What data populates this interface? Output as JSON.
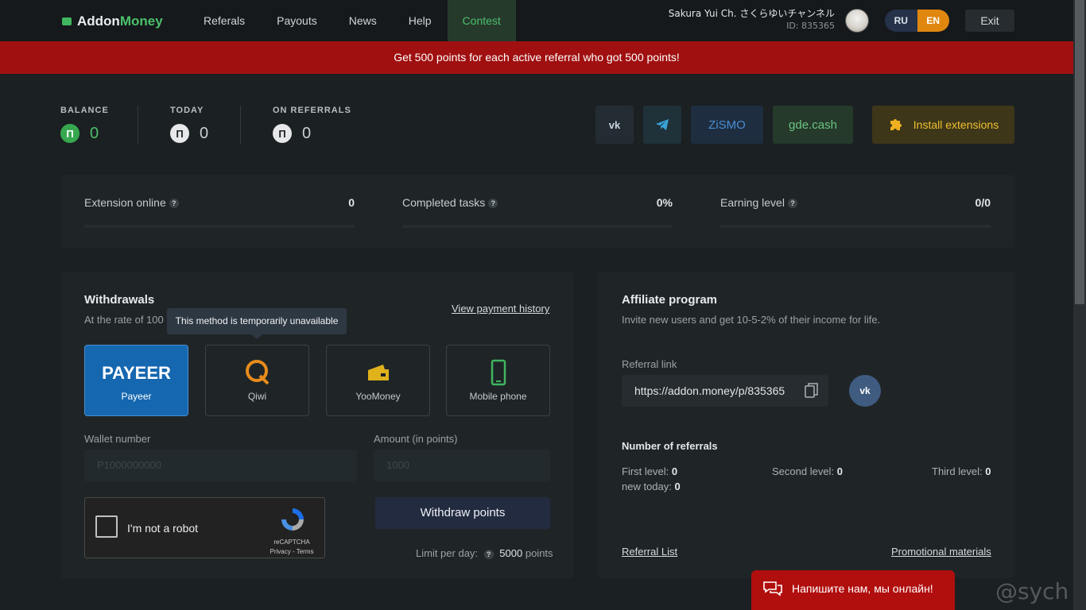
{
  "header": {
    "logo_part1": "Addon",
    "logo_part2": "Money",
    "nav": [
      "Referals",
      "Payouts",
      "News",
      "Help",
      "Contest"
    ],
    "user_name": "Sakura Yui Ch. さくらゆいチャンネル",
    "user_id": "ID: 835365",
    "lang_ru": "RU",
    "lang_en": "EN",
    "exit": "Exit"
  },
  "banner": "Get 500 points for each active referral who got 500 points!",
  "stats": {
    "balance_label": "BALANCE",
    "balance_value": "0",
    "today_label": "TODAY",
    "today_value": "0",
    "referrals_label": "ON REFERRALS",
    "referrals_value": "0",
    "coin_symbol": "П"
  },
  "social": {
    "vk": "vk",
    "zismo": "ZiSMO",
    "gdecash": "gde.cash",
    "install": "Install extensions"
  },
  "metrics": [
    {
      "label": "Extension online",
      "value": "0"
    },
    {
      "label": "Completed tasks",
      "value": "0%"
    },
    {
      "label": "Earning level",
      "value": "0/0"
    }
  ],
  "withdrawals": {
    "title": "Withdrawals",
    "rate": "At the rate of 100",
    "history": "View payment history",
    "tooltip": "This method is temporarily unavailable",
    "methods": [
      {
        "logo": "PAYEER",
        "label": "Payeer"
      },
      {
        "label": "Qiwi"
      },
      {
        "label": "YooMoney"
      },
      {
        "label": "Mobile phone"
      }
    ],
    "wallet_label": "Wallet number",
    "wallet_placeholder": "P1000000000",
    "amount_label": "Amount (in points)",
    "amount_placeholder": "1000",
    "captcha_text": "I'm not a robot",
    "captcha_brand": "reCAPTCHA",
    "captcha_links": "Privacy - Terms",
    "withdraw_button": "Withdraw points",
    "limit_label": "Limit per day:",
    "limit_value": "5000",
    "limit_unit": "points"
  },
  "affiliate": {
    "title": "Affiliate program",
    "subtitle": "Invite new users and get 10-5-2% of their income for life.",
    "ref_label": "Referral link",
    "ref_link": "https://addon.money/p/835365",
    "count_title": "Number of referrals",
    "first_label": "First level:",
    "first_value": "0",
    "second_label": "Second level:",
    "second_value": "0",
    "third_label": "Third level:",
    "third_value": "0",
    "today_label": "new today:",
    "today_value": "0",
    "list_link": "Referral List",
    "promo_link": "Promotional materials"
  },
  "chat": "Напишите нам, мы онлайн!",
  "watermark": "@sych",
  "colors": {
    "accent_green": "#4cc06a",
    "banner_red": "#a01010",
    "lang_en": "#e0870f",
    "payeer_blue": "#1567b0"
  }
}
